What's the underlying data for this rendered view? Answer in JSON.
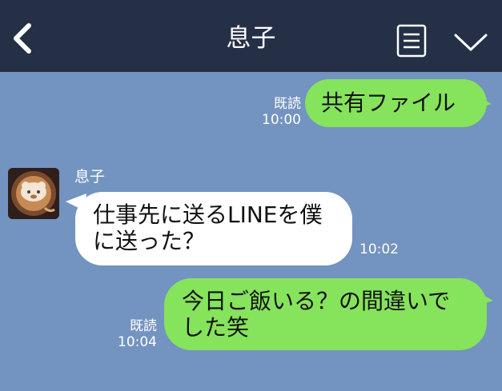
{
  "header": {
    "title": "息子",
    "back_icon": "chevron-left-icon",
    "notes_icon": "notes-icon",
    "menu_icon": "chevron-down-icon",
    "bg_color": "#253047"
  },
  "chat": {
    "bg_color": "#7393c0",
    "messages": [
      {
        "side": "right",
        "text": "共有ファイル",
        "read": "既読",
        "time": "10:00",
        "bubble_color": "#86e35c"
      },
      {
        "side": "left",
        "sender": "息子",
        "text": "仕事先に送るLINEを僕\nに送った？",
        "time": "10:02",
        "bubble_color": "#ffffff"
      },
      {
        "side": "right",
        "text": "今日ご飯いる？の間違いで\nした笑",
        "read": "既読",
        "time": "10:04",
        "bubble_color": "#86e35c"
      }
    ]
  }
}
